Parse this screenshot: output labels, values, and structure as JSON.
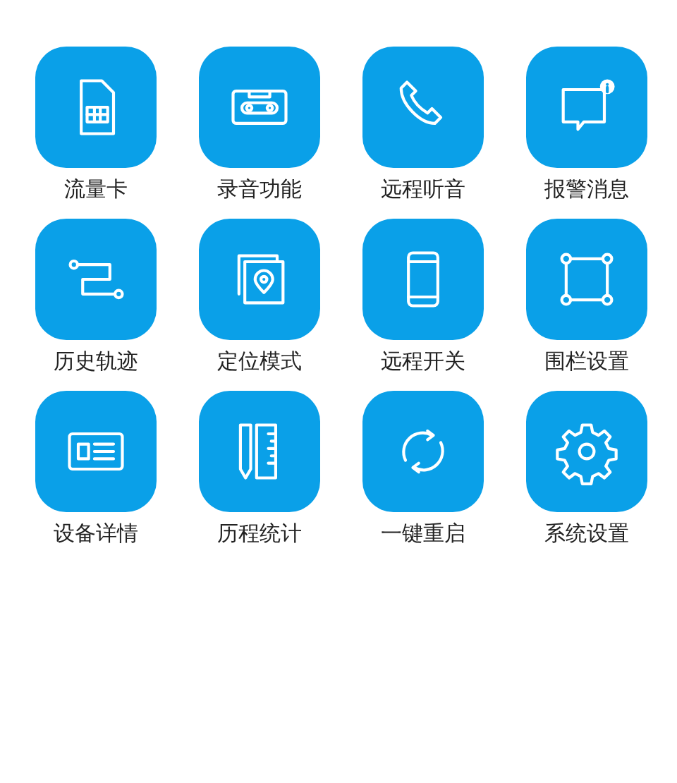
{
  "menu_items": [
    {
      "label": "流量卡"
    },
    {
      "label": "录音功能"
    },
    {
      "label": "远程听音"
    },
    {
      "label": "报警消息"
    },
    {
      "label": "历史轨迹"
    },
    {
      "label": "定位模式"
    },
    {
      "label": "远程开关"
    },
    {
      "label": "围栏设置"
    },
    {
      "label": "设备详情"
    },
    {
      "label": "历程统计"
    },
    {
      "label": "一键重启"
    },
    {
      "label": "系统设置"
    }
  ]
}
